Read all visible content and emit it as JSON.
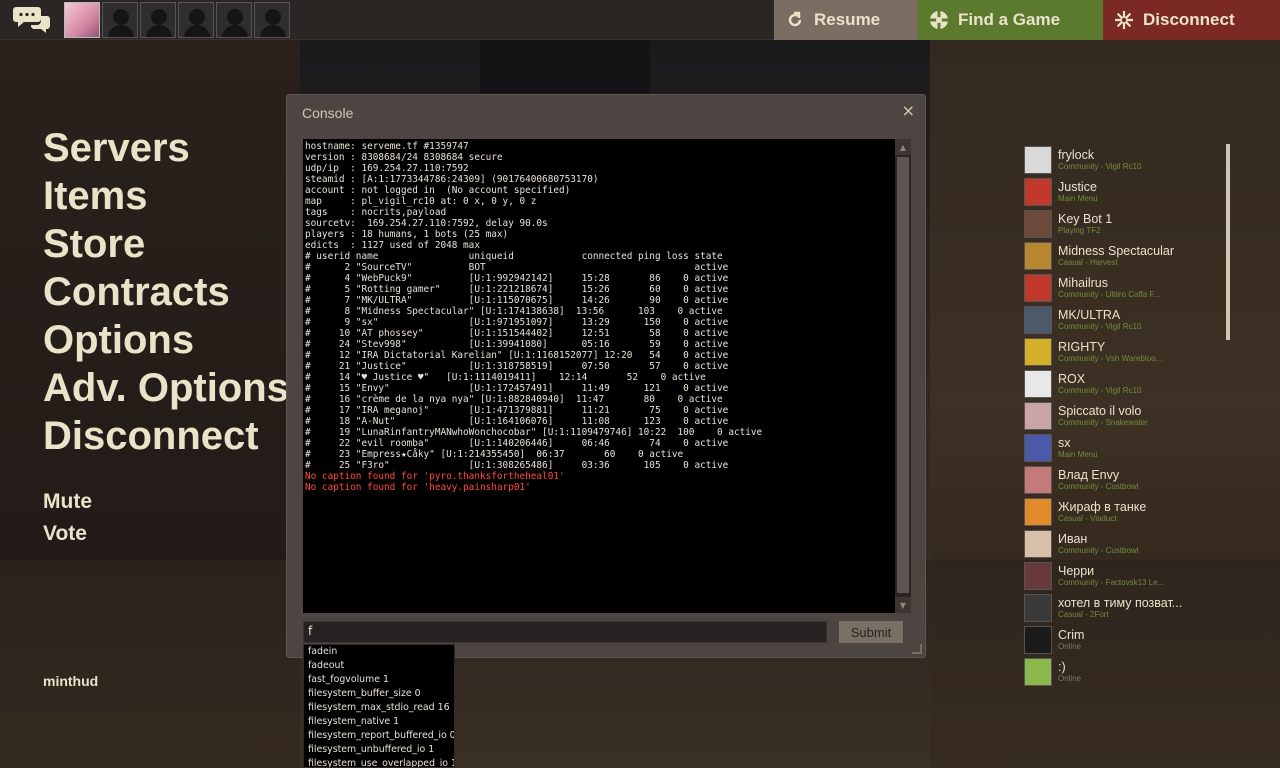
{
  "topbar": {
    "chat_icon": "chat-bubbles-icon",
    "party_avatars": [
      "self",
      "empty",
      "empty",
      "empty",
      "empty",
      "empty"
    ],
    "resume_label": "Resume",
    "resume_icon": "resume-arrow-icon",
    "find_game_label": "Find a Game",
    "find_game_icon": "find-game-icon",
    "disconnect_label": "Disconnect",
    "disconnect_icon": "disconnect-icon",
    "colors": {
      "resume": "#7a6e62",
      "find_game": "#5b7a2e",
      "disconnect": "#7a2a22"
    }
  },
  "main_menu": [
    "Servers",
    "Items",
    "Store",
    "Contracts",
    "Options",
    "Adv. Options",
    "Disconnect"
  ],
  "sub_menu": [
    "Mute",
    "Vote"
  ],
  "hud_label": "minthud",
  "console": {
    "title": "Console",
    "close": "×",
    "log_lines": [
      "hostname: serveme.tf #1359747",
      "version : 8308684/24 8308684 secure",
      "udp/ip  : 169.254.27.110:7592",
      "steamid : [A:1:1773344786:24309] (90176400680753170)",
      "account : not logged in  (No account specified)",
      "map     : pl_vigil_rc10 at: 0 x, 0 y, 0 z",
      "tags    : nocrits,payload",
      "sourcetv:  169.254.27.110:7592, delay 90.0s",
      "players : 18 humans, 1 bots (25 max)",
      "edicts  : 1127 used of 2048 max",
      "# userid name                uniqueid            connected ping loss state",
      "#      2 \"SourceTV\"          BOT                                     active",
      "#      4 \"WebPuck9\"          [U:1:992942142]     15:28       86    0 active",
      "#      5 \"Rotting gamer\"     [U:1:221218674]     15:26       60    0 active",
      "#      7 \"MK/ULTRA\"          [U:1:115070675]     14:26       90    0 active",
      "#      8 \"Midness Spectacular\" [U:1:174138638]  13:56      103    0 active",
      "#      9 \"sx\"                [U:1:971951097]     13:29      150    0 active",
      "#     10 \"AT phossey\"        [U:1:151544402]     12:51       58    0 active",
      "#     24 \"Stev998\"           [U:1:39941080]      05:16       59    0 active",
      "#     12 \"IRA Dictatorial Karelian\" [U:1:1168152077] 12:20   54    0 active",
      "#     21 \"Justice\"           [U:1:318758519]     07:50       57    0 active",
      "#     14 \"♥ Justice ♥\"   [U:1:1114019411]    12:14       52    0 active",
      "#     15 \"Envy\"              [U:1:172457491]     11:49      121    0 active",
      "#     16 \"crème de la nya nya\" [U:1:882840940]  11:47       80    0 active",
      "#     17 \"IRA meganoj\"       [U:1:471379881]     11:21       75    0 active",
      "#     18 \"A-Nut\"             [U:1:164106076]     11:08      123    0 active",
      "#     19 \"LunaRinfantryMANwhoWonchocobar\" [U:1:1109479746] 10:22  100    0 active",
      "#     22 \"evil roomba\"       [U:1:140206446]     06:46       74    0 active",
      "#     23 \"Empress★Cåky\" [U:1:214355450]  06:37       60    0 active",
      "#     25 \"F3ro\"              [U:1:308265486]     03:36      105    0 active"
    ],
    "error_lines": [
      "No caption found for 'pyro.thanksfortheheal01'",
      "No caption found for 'heavy.painsharp01'"
    ],
    "error_color": "#ff4a3d",
    "input_value": "f",
    "submit_label": "Submit"
  },
  "autocomplete": [
    "fadein",
    "fadeout",
    "fast_fogvolume 1",
    "filesystem_buffer_size 0",
    "filesystem_max_stdio_read 16",
    "filesystem_native 1",
    "filesystem_report_buffered_io 0",
    "filesystem_unbuffered_io 1",
    "filesystem_use_overlapped_io 1"
  ],
  "friends": [
    {
      "name": "frylock",
      "status": "Community - Vigil Rc10",
      "online_color": "#6e8f3a",
      "avatar_color": "#d9d9d9"
    },
    {
      "name": "Justice",
      "status": "Main Menu",
      "online_color": "#6e8f3a",
      "avatar_color": "#c0392b"
    },
    {
      "name": "Key Bot 1",
      "status": "Playing TF2",
      "online_color": "#6e8f3a",
      "avatar_color": "#6b4a3a"
    },
    {
      "name": "Midness Spectacular",
      "status": "Casual - Harvest",
      "online_color": "#6e8f3a",
      "avatar_color": "#b8862e"
    },
    {
      "name": "Mihailrus",
      "status": "Community - Ultiiro Caffa F...",
      "online_color": "#6e8f3a",
      "avatar_color": "#c0392b"
    },
    {
      "name": "MK/ULTRA",
      "status": "Community - Vigil Rc10",
      "online_color": "#6e8f3a",
      "avatar_color": "#4a5a6a"
    },
    {
      "name": "RIGHTY",
      "status": "Community - Vsh Warebloo...",
      "online_color": "#6e8f3a",
      "avatar_color": "#d4b02a"
    },
    {
      "name": "ROX",
      "status": "Community - Vigil Rc10",
      "online_color": "#6e8f3a",
      "avatar_color": "#e8e8e8"
    },
    {
      "name": "Spiccato il volo",
      "status": "Community - Snakewater",
      "online_color": "#6e8f3a",
      "avatar_color": "#c9a5a5"
    },
    {
      "name": "sx",
      "status": "Main Menu",
      "online_color": "#6e8f3a",
      "avatar_color": "#4a5aa8"
    },
    {
      "name": "Влад Envy",
      "status": "Community - Cuѕtbowl",
      "online_color": "#6e8f3a",
      "avatar_color": "#c47a7a"
    },
    {
      "name": "Жираф в танке",
      "status": "Casual - Viaduct",
      "online_color": "#6e8f3a",
      "avatar_color": "#e08a2a"
    },
    {
      "name": "Иван",
      "status": "Community - Cuѕtbowl",
      "online_color": "#6e8f3a",
      "avatar_color": "#d8c0a8"
    },
    {
      "name": "Черри",
      "status": "Community - Factovsk13 Le...",
      "online_color": "#6e8f3a",
      "avatar_color": "#6a3a3a"
    },
    {
      "name": "хотел в тиму позват...",
      "status": "Casual - 2Fort",
      "online_color": "#6e8f3a",
      "avatar_color": "#3a3a3a"
    },
    {
      "name": "Crim",
      "status": "Online",
      "online_color": "#7c7872",
      "avatar_color": "#1a1a1a"
    },
    {
      "name": ":)",
      "status": "Online",
      "online_color": "#7c7872",
      "avatar_color": "#8ab84a"
    }
  ]
}
